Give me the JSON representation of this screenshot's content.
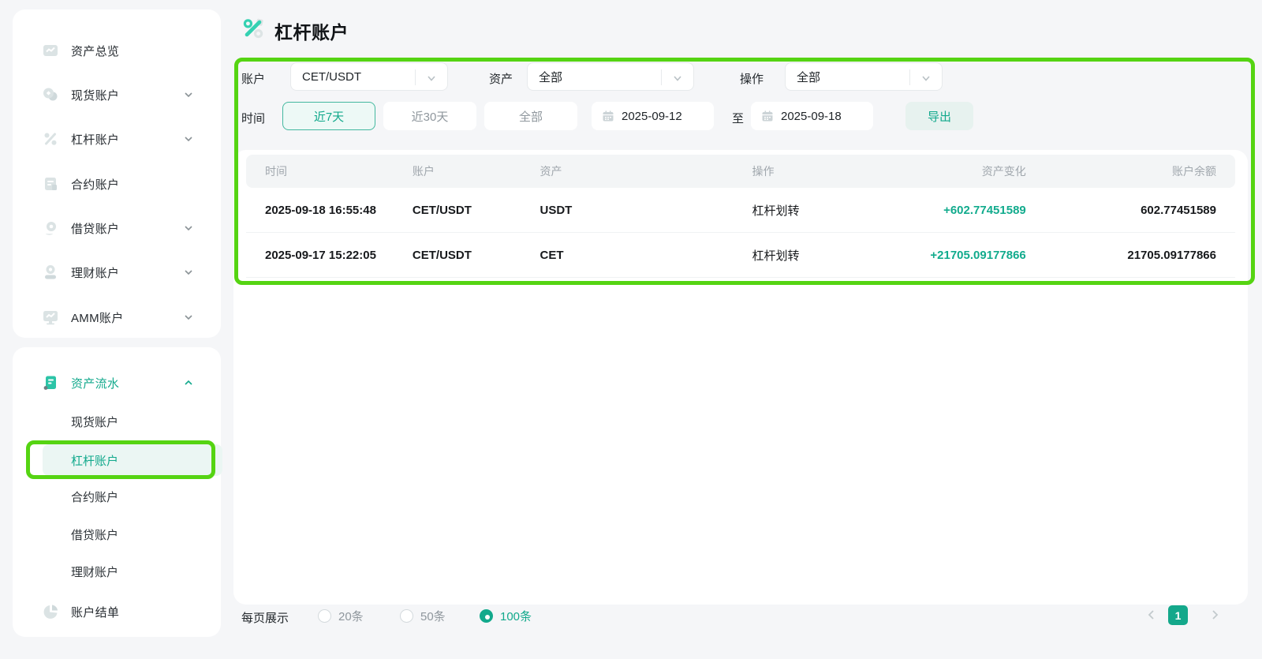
{
  "colors": {
    "accent_teal": "#12a98c",
    "positive_change": "#12ab8d",
    "annotation_green": "#55d412",
    "page_background": "#f5f6f8",
    "table_header_bg": "#f3f5f6"
  },
  "sidebar": {
    "primary": [
      {
        "label": "资产总览"
      },
      {
        "label": "现货账户"
      },
      {
        "label": "杠杆账户"
      },
      {
        "label": "合约账户"
      },
      {
        "label": "借贷账户"
      },
      {
        "label": "理财账户"
      },
      {
        "label": "AMM账户"
      }
    ],
    "flow_header": {
      "label": "资产流水"
    },
    "flow_items": [
      {
        "label": "现货账户"
      },
      {
        "label": "杠杆账户"
      },
      {
        "label": "合约账户"
      },
      {
        "label": "借贷账户"
      },
      {
        "label": "理财账户"
      }
    ],
    "active_flow_item": "杠杆账户",
    "statement": {
      "label": "账户结单"
    }
  },
  "header": {
    "title": "杠杆账户"
  },
  "filters": {
    "account_label": "账户",
    "account_value": "CET/USDT",
    "asset_label": "资产",
    "asset_value": "全部",
    "operation_label": "操作",
    "operation_value": "全部",
    "time_label": "时间",
    "range_7d": "近7天",
    "range_30d": "近30天",
    "range_all": "全部",
    "range_selected": "近7天",
    "date_from": "2025-09-12",
    "to_label": "至",
    "date_to": "2025-09-18",
    "export_label": "导出"
  },
  "table": {
    "headers": [
      "时间",
      "账户",
      "资产",
      "操作",
      "资产变化",
      "账户余额"
    ],
    "rows": [
      {
        "time": "2025-09-18 16:55:48",
        "account": "CET/USDT",
        "asset": "USDT",
        "operation": "杠杆划转",
        "change": "+602.77451589",
        "balance": "602.77451589"
      },
      {
        "time": "2025-09-17 15:22:05",
        "account": "CET/USDT",
        "asset": "CET",
        "operation": "杠杆划转",
        "change": "+21705.09177866",
        "balance": "21705.09177866"
      }
    ]
  },
  "pagination": {
    "per_page_label": "每页展示",
    "opt_20": "20条",
    "opt_50": "50条",
    "opt_100": "100条",
    "selected_option": "100条",
    "current_page": "1"
  }
}
